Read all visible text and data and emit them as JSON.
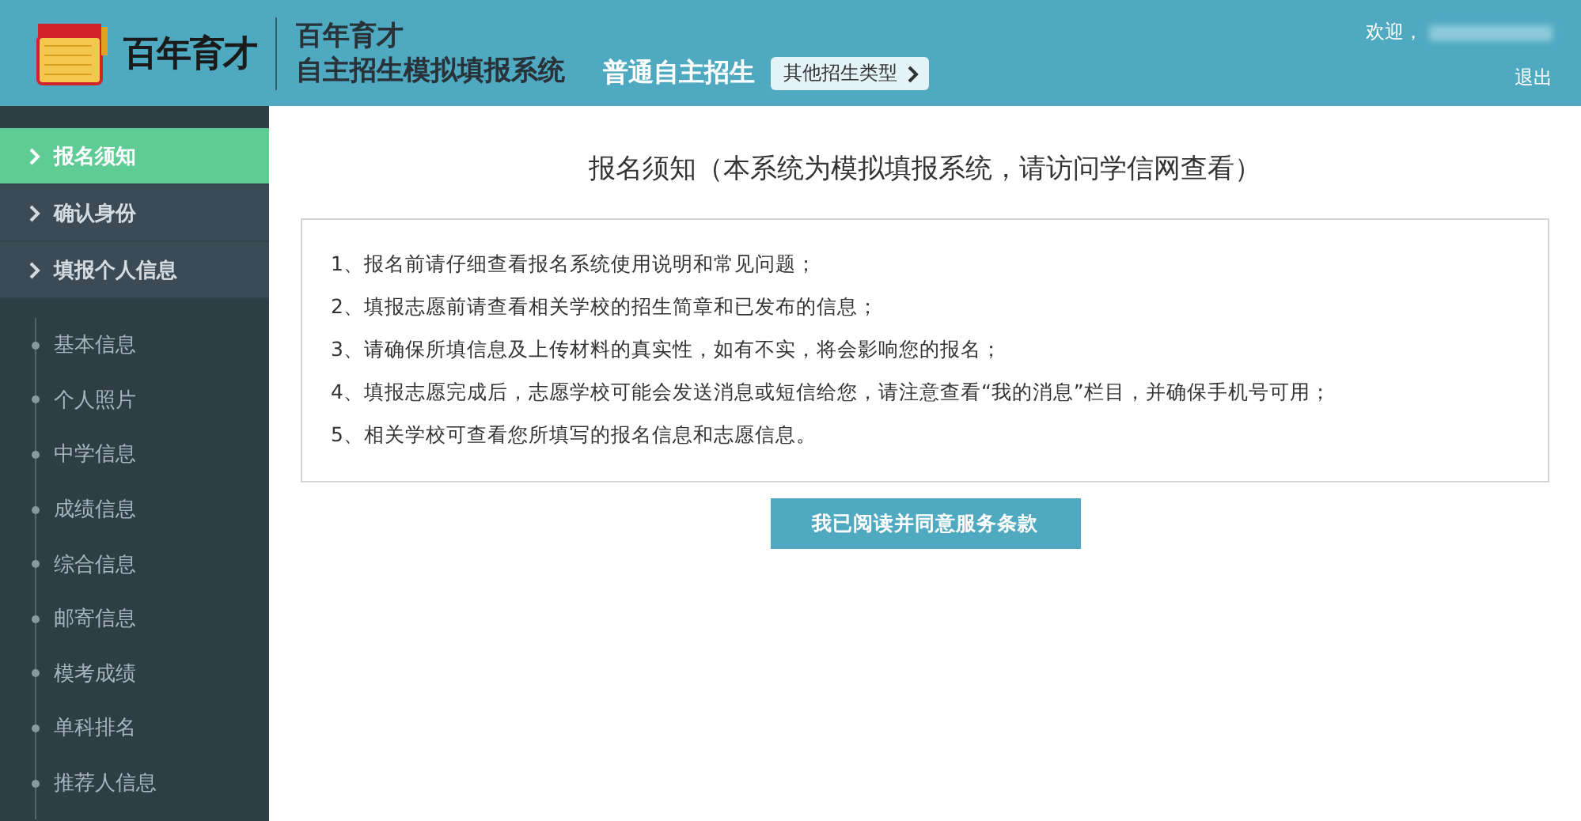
{
  "header": {
    "logo_text": "百年育才",
    "brand": "百年育才",
    "system_title": "自主招生模拟填报系统",
    "mode": "普通自主招生",
    "switch_button": "其他招生类型",
    "welcome": "欢迎，",
    "logout": "退出"
  },
  "sidebar": {
    "steps": [
      {
        "label": "报名须知",
        "selected": true
      },
      {
        "label": "确认身份",
        "selected": false
      },
      {
        "label": "填报个人信息",
        "selected": false
      }
    ],
    "sub_items": [
      "基本信息",
      "个人照片",
      "中学信息",
      "成绩信息",
      "综合信息",
      "邮寄信息",
      "模考成绩",
      "单科排名",
      "推荐人信息"
    ]
  },
  "notice": {
    "title": "报名须知（本系统为模拟填报系统，请访问学信网查看）",
    "items": [
      "1、报名前请仔细查看报名系统使用说明和常见问题；",
      "2、填报志愿前请查看相关学校的招生简章和已发布的信息；",
      "3、请确保所填信息及上传材料的真实性，如有不实，将会影响您的报名；",
      "4、填报志愿完成后，志愿学校可能会发送消息或短信给您，请注意查看“我的消息”栏目，并确保手机号可用；",
      "5、相关学校可查看您所填写的报名信息和志愿信息。"
    ],
    "agree_button": "我已阅读并同意服务条款"
  }
}
